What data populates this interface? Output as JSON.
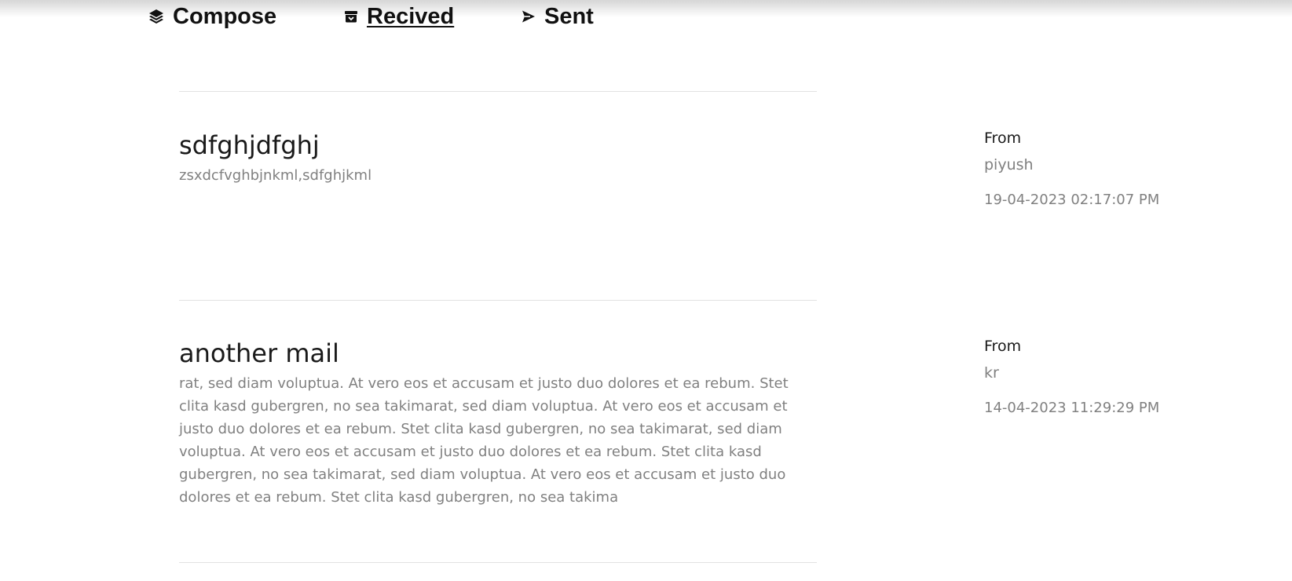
{
  "nav": {
    "compose": {
      "label": "Compose",
      "icon": "layers-icon"
    },
    "recived": {
      "label": "Recived",
      "icon": "archive-icon",
      "active": true
    },
    "sent": {
      "label": "Sent",
      "icon": "send-icon"
    }
  },
  "mails": [
    {
      "subject": "sdfghjdfghj",
      "body": "zsxdcfvghbjnkml,sdfghjkml",
      "from_label": "From",
      "from": "piyush",
      "date": "19-04-2023 02:17:07 PM"
    },
    {
      "subject": "another mail",
      "body": "rat, sed diam voluptua. At vero eos et accusam et justo duo dolores et ea rebum. Stet clita kasd gubergren, no sea takimarat, sed diam voluptua. At vero eos et accusam et justo duo dolores et ea rebum. Stet clita kasd gubergren, no sea takimarat, sed diam voluptua. At vero eos et accusam et justo duo dolores et ea rebum. Stet clita kasd gubergren, no sea takimarat, sed diam voluptua. At vero eos et accusam et justo duo dolores et ea rebum. Stet clita kasd gubergren, no sea takima",
      "from_label": "From",
      "from": "kr",
      "date": "14-04-2023 11:29:29 PM"
    }
  ]
}
